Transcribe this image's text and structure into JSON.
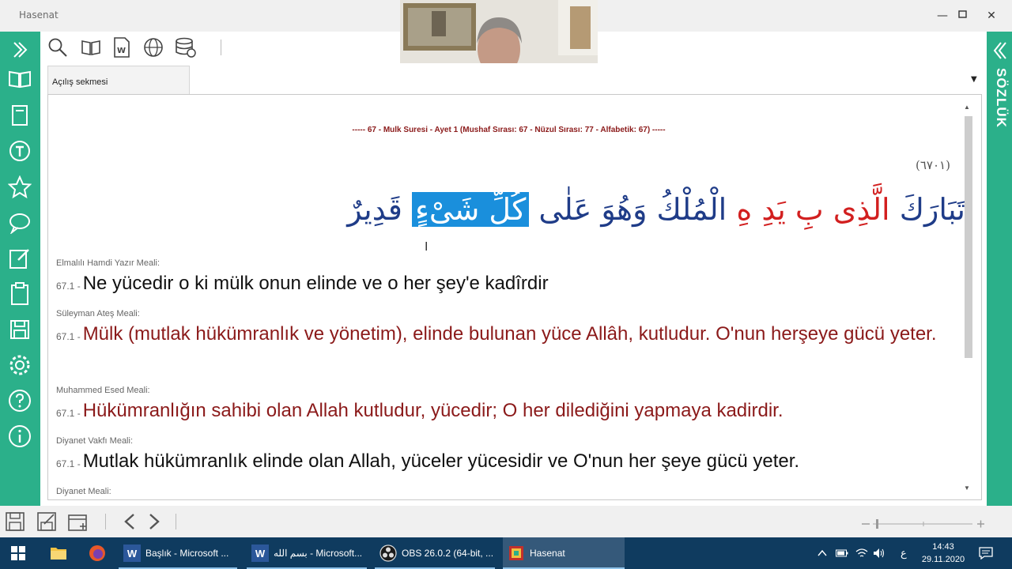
{
  "window": {
    "title": "Hasenat"
  },
  "tab": {
    "label": "Açılış sekmesi"
  },
  "right_panel": {
    "label": "SÖZLÜK"
  },
  "verse": {
    "header": "-----   67 - Mulk Suresi - Ayet 1 (Mushaf Sırası: 67 - Nüzul Sırası: 77 - Alfabetik: 67)   -----",
    "number_label": "(٦٧٠١)",
    "arabic_blue_1": "تَبَارَكَ",
    "arabic_red": "الَّذِى بِ يَدِ هِ",
    "arabic_blue_2": "الْمُلْكُ وَهُوَ عَلٰى",
    "arabic_highlight": "كُلِّ شَىْءٍ",
    "arabic_blue_3": "قَدِيرٌ"
  },
  "meals": [
    {
      "name": "Elmalılı Hamdi Yazır Meali:",
      "ref": "67.1 -",
      "text": "Ne yücedir o ki mülk onun elinde ve o her şey'e kadîrdir"
    },
    {
      "name": "Süleyman Ateş Meali:",
      "ref": "67.1 -",
      "text": "Mülk (mutlak hükümranlık ve yönetim), elinde bulunan yüce Allâh, kutludur. O'nun herşeye gücü yeter."
    },
    {
      "name": "Muhammed Esed Meali:",
      "ref": "67.1 -",
      "text": "Hükümranlığın sahibi olan Allah kutludur, yücedir; O her dilediğini yapmaya kadirdir."
    },
    {
      "name": "Diyanet Vakfı Meali:",
      "ref": "67.1 -",
      "text": "Mutlak hükümranlık elinde olan Allah, yüceler yücesidir ve O'nun her şeye gücü yeter."
    },
    {
      "name": "Diyanet Meali:"
    }
  ],
  "taskbar": {
    "apps": [
      {
        "label": "Başlık - Microsoft ...",
        "icon": "word-icon"
      },
      {
        "label": "بسم الله - Microsoft...",
        "icon": "word-icon"
      },
      {
        "label": "OBS 26.0.2 (64-bit, ...",
        "icon": "obs-icon"
      },
      {
        "label": "Hasenat",
        "icon": "hasenat-icon"
      }
    ],
    "lang": "ع",
    "time": "14:43",
    "date": "29.11.2020"
  },
  "colors": {
    "accent": "#2bb08a",
    "taskbar": "#0f3b5f",
    "maroon": "#8b1a1a",
    "arabic_blue": "#1f3c88",
    "arabic_red": "#d21f1f",
    "highlight": "#1a8fdc"
  }
}
